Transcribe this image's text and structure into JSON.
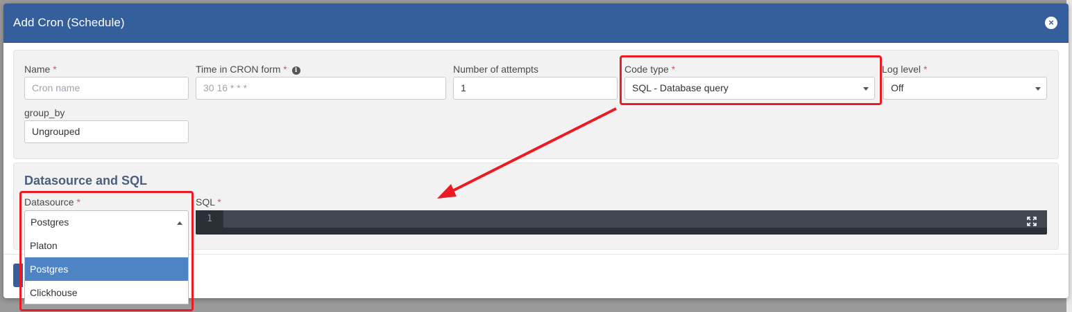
{
  "modal": {
    "title": "Add Cron (Schedule)",
    "close_label": "×"
  },
  "form": {
    "name": {
      "label": "Name",
      "required": "*",
      "placeholder": "Cron name",
      "value": ""
    },
    "cron_time": {
      "label": "Time in CRON form",
      "required": "*",
      "placeholder": "30 16 * * *",
      "value": ""
    },
    "attempts": {
      "label": "Number of attempts",
      "value": "1"
    },
    "code_type": {
      "label": "Code type",
      "required": "*",
      "value": "SQL - Database query"
    },
    "log_level": {
      "label": "Log level",
      "required": "*",
      "value": "Off"
    },
    "group_by": {
      "label": "group_by",
      "value": "Ungrouped"
    }
  },
  "datasource_section": {
    "title": "Datasource and SQL",
    "datasource": {
      "label": "Datasource",
      "required": "*",
      "value": "Postgres",
      "options": [
        "Platon",
        "Postgres",
        "Clickhouse"
      ],
      "selected_option": "Postgres"
    },
    "sql": {
      "label": "SQL",
      "required": "*",
      "line_number": "1"
    }
  },
  "colors": {
    "header": "#345f9c",
    "highlight": "#ea1b22",
    "selected_option": "#4f84c4",
    "editor_bg": "#2b2f36"
  },
  "icons": {
    "close": "close-circle-icon",
    "info": "info-icon",
    "expand": "expand-icon",
    "caret": "caret-down-icon"
  }
}
